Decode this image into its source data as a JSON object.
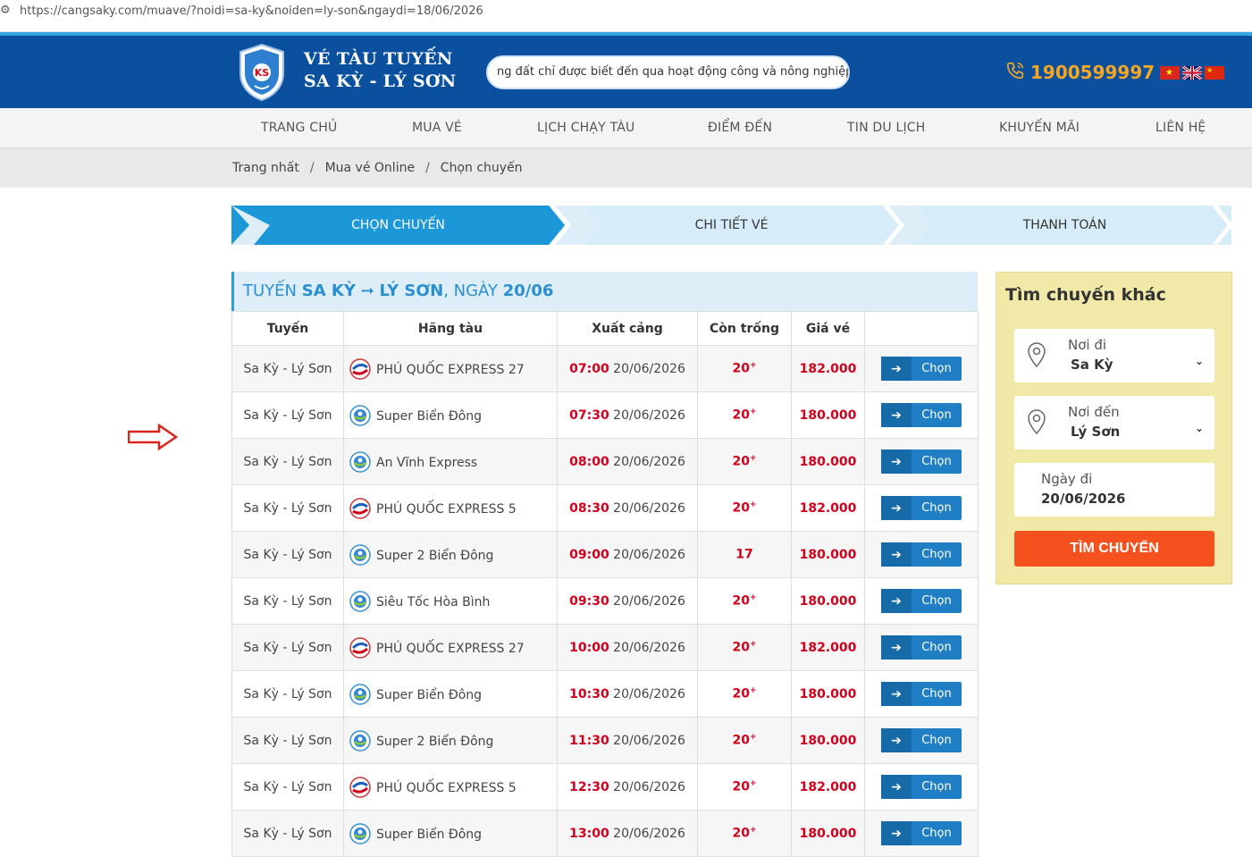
{
  "browser": {
    "url": "https://cangsaky.com/muave/?noidi=sa-ky&noiden=ly-son&ngaydi=18/06/2026"
  },
  "header": {
    "brand_line1": "VÉ TÀU TUYẾN",
    "brand_line2": "SA KỲ - LÝ SƠN",
    "marquee_text": "ng đất chỉ được biết đến qua hoạt động công và nông nghiệp",
    "phone": "1900599997",
    "colors": {
      "header_bg": "#0b4f9f",
      "phone": "#f5a623",
      "accent": "#2a9fd8"
    }
  },
  "nav": {
    "items": [
      "TRANG CHỦ",
      "MUA VÉ",
      "LỊCH CHẠY TÀU",
      "ĐIỂM ĐẾN",
      "TIN DU LỊCH",
      "KHUYẾN MÃI",
      "LIÊN HỆ"
    ]
  },
  "breadcrumb": [
    "Trang nhất",
    "Mua vé Online",
    "Chọn chuyến"
  ],
  "steps": [
    {
      "label": "CHỌN CHUYẾN",
      "active": true
    },
    {
      "label": "CHI TIẾT VÉ",
      "active": false
    },
    {
      "label": "THANH TOÁN",
      "active": false
    }
  ],
  "route_title": {
    "prefix": "TUYẾN",
    "from": "SA KỲ",
    "to": "LÝ SƠN",
    "date_prefix": ", NGÀY",
    "date": "20/06"
  },
  "table": {
    "headers": [
      "Tuyến",
      "Hãng tàu",
      "Xuất cảng",
      "Còn trống",
      "Giá vé",
      ""
    ],
    "button_label": "Chọn",
    "rows": [
      {
        "route": "Sa Kỳ - Lý Sơn",
        "ship": "PHÚ QUỐC EXPRESS 27",
        "logo": "phu-quoc",
        "time": "07:00",
        "date": "20/06/2026",
        "seats": "20",
        "plus": "+",
        "price": "182.000"
      },
      {
        "route": "Sa Kỳ - Lý Sơn",
        "ship": "Super Biển Đông",
        "logo": "super",
        "time": "07:30",
        "date": "20/06/2026",
        "seats": "20",
        "plus": "+",
        "price": "180.000"
      },
      {
        "route": "Sa Kỳ - Lý Sơn",
        "ship": "An Vĩnh Express",
        "logo": "super",
        "time": "08:00",
        "date": "20/06/2026",
        "seats": "20",
        "plus": "+",
        "price": "180.000"
      },
      {
        "route": "Sa Kỳ - Lý Sơn",
        "ship": "PHÚ QUỐC EXPRESS 5",
        "logo": "phu-quoc",
        "time": "08:30",
        "date": "20/06/2026",
        "seats": "20",
        "plus": "+",
        "price": "182.000"
      },
      {
        "route": "Sa Kỳ - Lý Sơn",
        "ship": "Super 2 Biển Đông",
        "logo": "super",
        "time": "09:00",
        "date": "20/06/2026",
        "seats": "17",
        "plus": "",
        "price": "180.000"
      },
      {
        "route": "Sa Kỳ - Lý Sơn",
        "ship": "Siêu Tốc Hòa Bình",
        "logo": "super",
        "time": "09:30",
        "date": "20/06/2026",
        "seats": "20",
        "plus": "+",
        "price": "180.000"
      },
      {
        "route": "Sa Kỳ - Lý Sơn",
        "ship": "PHÚ QUỐC EXPRESS 27",
        "logo": "phu-quoc",
        "time": "10:00",
        "date": "20/06/2026",
        "seats": "20",
        "plus": "+",
        "price": "182.000"
      },
      {
        "route": "Sa Kỳ - Lý Sơn",
        "ship": "Super Biển Đông",
        "logo": "super",
        "time": "10:30",
        "date": "20/06/2026",
        "seats": "20",
        "plus": "+",
        "price": "180.000"
      },
      {
        "route": "Sa Kỳ - Lý Sơn",
        "ship": "Super 2 Biển Đông",
        "logo": "super",
        "time": "11:30",
        "date": "20/06/2026",
        "seats": "20",
        "plus": "+",
        "price": "180.000"
      },
      {
        "route": "Sa Kỳ - Lý Sơn",
        "ship": "PHÚ QUỐC EXPRESS 5",
        "logo": "phu-quoc",
        "time": "12:30",
        "date": "20/06/2026",
        "seats": "20",
        "plus": "+",
        "price": "182.000"
      },
      {
        "route": "Sa Kỳ - Lý Sơn",
        "ship": "Super Biển Đông",
        "logo": "super",
        "time": "13:00",
        "date": "20/06/2026",
        "seats": "20",
        "plus": "+",
        "price": "180.000"
      }
    ]
  },
  "sidebar": {
    "title": "Tìm chuyến khác",
    "from_label": "Nơi đi",
    "from_value": "Sa Kỳ",
    "to_label": "Nơi đến",
    "to_value": "Lý Sơn",
    "date_label": "Ngày đi",
    "date_value": "20/06/2026",
    "search_button": "TÌM CHUYẾN"
  }
}
